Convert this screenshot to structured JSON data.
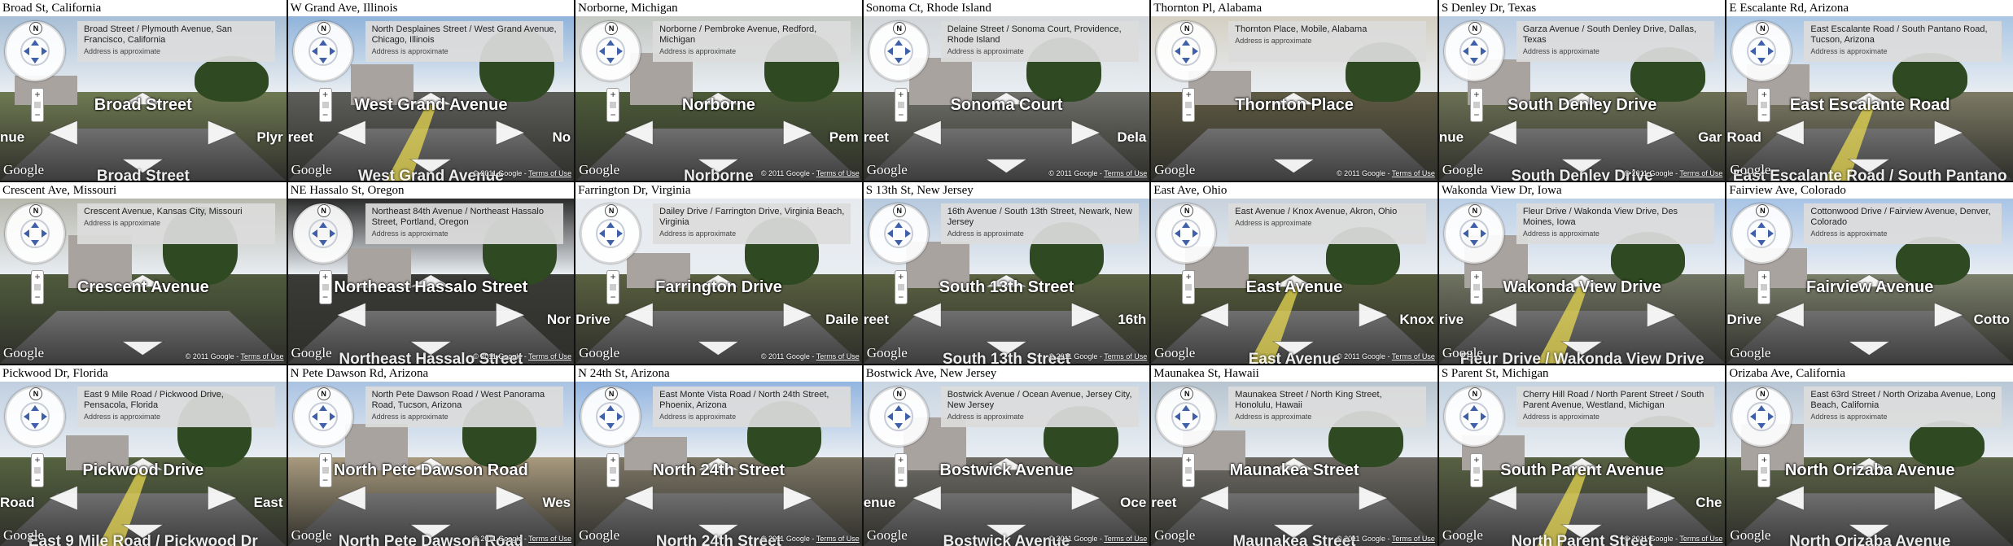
{
  "panels": [
    {
      "title": "Broad St, California",
      "address": "Broad Street / Plymouth Avenue, San Francisco, California",
      "street": "Broad Street",
      "left": "nue",
      "right": "Plyr",
      "bottom": "Broad Street",
      "yellow": false,
      "sky": "#a8bfd6",
      "ground": "#6f7a52",
      "copyright": false,
      "arrows": 4
    },
    {
      "title": "W Grand Ave, Illinois",
      "address": "North Desplaines Street / West Grand Avenue, Chicago, Illinois",
      "street": "West Grand Avenue",
      "left": "reet",
      "right": "No",
      "bottom": "West Grand Avenue",
      "yellow": true,
      "sky": "#8fb3da",
      "ground": "#5d5e5a",
      "copyright": true,
      "arrows": 4
    },
    {
      "title": "Norborne, Michigan",
      "address": "Norborne / Pembroke Avenue, Redford, Michigan",
      "street": "Norborne",
      "left": "",
      "right": "Pem",
      "bottom": "Norborne",
      "yellow": false,
      "sky": "#c4c9c4",
      "ground": "#4c5b38",
      "copyright": true,
      "arrows": 4
    },
    {
      "title": "Sonoma Ct, Rhode Island",
      "address": "Delaine Street / Sonoma Court, Providence, Rhode Island",
      "street": "Sonoma Court",
      "left": "reet",
      "right": "Dela",
      "bottom": "",
      "yellow": false,
      "sky": "#d3d7da",
      "ground": "#6e6f68",
      "copyright": true,
      "arrows": 4
    },
    {
      "title": "Thornton Pl, Alabama",
      "address": "Thornton Place, Mobile, Alabama",
      "street": "Thornton Place",
      "left": "",
      "right": "",
      "bottom": "",
      "yellow": false,
      "sky": "#d4cfc2",
      "ground": "#5e5a43",
      "copyright": true,
      "arrows": 2
    },
    {
      "title": "S Denley Dr, Texas",
      "address": "Garza Avenue / South Denley Drive, Dallas, Texas",
      "street": "South Denley Drive",
      "left": "nue",
      "right": "Gar",
      "bottom": "South Denley Drive",
      "yellow": false,
      "sky": "#b9cbe0",
      "ground": "#6c7154",
      "copyright": true,
      "arrows": 4
    },
    {
      "title": "E Escalante Rd, Arizona",
      "address": "East Escalante Road / South Pantano Road, Tucson, Arizona",
      "street": "East Escalante Road",
      "left": "Road",
      "right": "",
      "bottom": "East Escalante Road / South Pantano",
      "yellow": true,
      "sky": "#a9c6e4",
      "ground": "#7d7b65",
      "copyright": false,
      "arrows": 4
    },
    {
      "title": "Crescent Ave, Missouri",
      "address": "Crescent Avenue, Kansas City, Missouri",
      "street": "Crescent Avenue",
      "left": "",
      "right": "",
      "bottom": "",
      "yellow": false,
      "sky": "#b7b8ad",
      "ground": "#4f5b3c",
      "copyright": true,
      "arrows": 2
    },
    {
      "title": "NE Hassalo St, Oregon",
      "address": "Northeast 84th Avenue / Northeast Hassalo Street, Portland, Oregon",
      "street": "Northeast Hassalo Street",
      "left": "",
      "right": "Nor",
      "bottom": "Northeast Hassalo Street",
      "yellow": false,
      "sky": "#2b2b2b",
      "ground": "#3a3a36",
      "copyright": true,
      "arrows": 4
    },
    {
      "title": "Farrington Dr, Virginia",
      "address": "Dailey Drive / Farrington Drive, Virginia Beach, Virginia",
      "street": "Farrington Drive",
      "left": "Drive",
      "right": "Daile",
      "bottom": "",
      "yellow": false,
      "sky": "#e7ebef",
      "ground": "#59603f",
      "copyright": true,
      "arrows": 4
    },
    {
      "title": "S 13th St, New Jersey",
      "address": "16th Avenue / South 13th Street, Newark, New Jersey",
      "street": "South 13th Street",
      "left": "reet",
      "right": "16th",
      "bottom": "South 13th Street",
      "yellow": false,
      "sky": "#b6c9de",
      "ground": "#5b6342",
      "copyright": true,
      "arrows": 4
    },
    {
      "title": "East Ave, Ohio",
      "address": "East Avenue / Knox Avenue, Akron, Ohio",
      "street": "East Avenue",
      "left": "",
      "right": "Knox",
      "bottom": "East Avenue",
      "yellow": true,
      "sky": "#c8d1dc",
      "ground": "#535a3a",
      "copyright": true,
      "arrows": 4
    },
    {
      "title": "Wakonda View Dr, Iowa",
      "address": "Fleur Drive / Wakonda View Drive, Des Moines, Iowa",
      "street": "Wakonda View Drive",
      "left": "rive",
      "right": "",
      "bottom": "Fleur Drive / Wakonda View Drive",
      "yellow": true,
      "sky": "#bcd0e7",
      "ground": "#707462",
      "copyright": false,
      "arrows": 4
    },
    {
      "title": "Fairview Ave, Colorado",
      "address": "Cottonwood Drive / Fairview Avenue, Denver, Colorado",
      "street": "Fairview Avenue",
      "left": "Drive",
      "right": "Cotto",
      "bottom": "",
      "yellow": false,
      "sky": "#a8c4e6",
      "ground": "#7b806b",
      "copyright": false,
      "arrows": 4
    },
    {
      "title": "Pickwood Dr, Florida",
      "address": "East 9 Mile Road / Pickwood Drive, Pensacola, Florida",
      "street": "Pickwood Drive",
      "left": "Road",
      "right": "East",
      "bottom": "East 9 Mile Road / Pickwood Dr",
      "yellow": true,
      "sky": "#c0cfe0",
      "ground": "#556340",
      "copyright": false,
      "arrows": 4
    },
    {
      "title": "N Pete Dawson Rd, Arizona",
      "address": "North Pete Dawson Road / West Panorama Road, Tucson, Arizona",
      "street": "North Pete Dawson Road",
      "left": "",
      "right": "Wes",
      "bottom": "North Pete Dawson Road",
      "yellow": false,
      "sky": "#aac3e2",
      "ground": "#a89a7e",
      "copyright": true,
      "arrows": 4
    },
    {
      "title": "N 24th St, Arizona",
      "address": "East Monte Vista Road / North 24th Street, Phoenix, Arizona",
      "street": "North 24th Street",
      "left": "",
      "right": "",
      "bottom": "North 24th Street",
      "yellow": false,
      "sky": "#92b5e0",
      "ground": "#7d7766",
      "copyright": true,
      "arrows": 4
    },
    {
      "title": "Bostwick Ave, New Jersey",
      "address": "Bostwick Avenue / Ocean Avenue, Jersey City, New Jersey",
      "street": "Bostwick Avenue",
      "left": "enue",
      "right": "Oce",
      "bottom": "Bostwick Avenue",
      "yellow": false,
      "sky": "#c9d6e3",
      "ground": "#6f6c66",
      "copyright": true,
      "arrows": 4
    },
    {
      "title": "Maunakea St, Hawaii",
      "address": "Maunakea Street / North King Street, Honolulu, Hawaii",
      "street": "Maunakea Street",
      "left": "reet",
      "right": "",
      "bottom": "Maunakea Street",
      "yellow": false,
      "sky": "#b7c4cf",
      "ground": "#6d6a63",
      "copyright": true,
      "arrows": 4
    },
    {
      "title": "S Parent St, Michigan",
      "address": "Cherry Hill Road / North Parent Street / South Parent Avenue, Westland, Michigan",
      "street": "South Parent Avenue",
      "left": "",
      "right": "Che",
      "bottom": "North Parent Street",
      "yellow": true,
      "sky": "#c4d2e0",
      "ground": "#586143",
      "copyright": true,
      "arrows": 4
    },
    {
      "title": "Orizaba Ave, California",
      "address": "East 63rd Street / North Orizaba Avenue, Long Beach, California",
      "street": "North Orizaba Avenue",
      "left": "",
      "right": "",
      "bottom": "North Orizaba Avenue",
      "yellow": false,
      "sky": "#b8c7d6",
      "ground": "#5c6448",
      "copyright": false,
      "arrows": 4
    }
  ],
  "common": {
    "approx": "Address is approximate",
    "google": "Google",
    "copyright": "© 2011 Google",
    "terms": "Terms of Use",
    "north": "N",
    "zoom_in": "+",
    "zoom_out": "−"
  }
}
